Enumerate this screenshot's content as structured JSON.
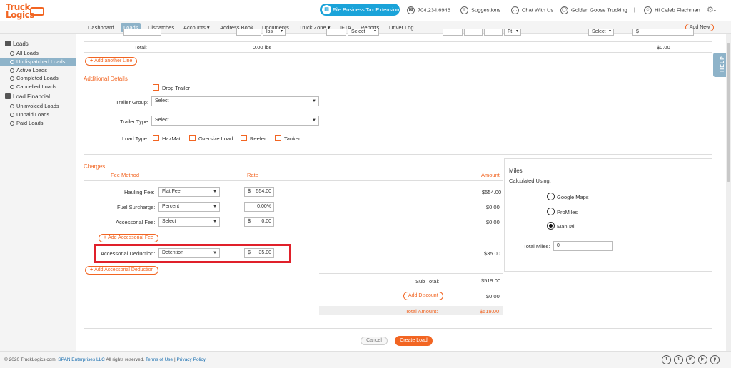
{
  "header": {
    "logo_line1": "Truck",
    "logo_line2": "Logics",
    "tax_button": "File Business Tax Extension",
    "phone": "704.234.6946",
    "suggestions": "Suggestions",
    "chat": "Chat With Us",
    "company": "Golden Goose Trucking",
    "separator": "|",
    "greeting": "Hi Caleb Flachman"
  },
  "nav": {
    "items": [
      "Dashboard",
      "Loads",
      "Dispatches",
      "Accounts ▾",
      "Address Book",
      "Documents",
      "Truck Zone ▾",
      "IFTA",
      "Reports",
      "Driver Log"
    ],
    "add_new": "Add New"
  },
  "sidebar": {
    "loads_head": "Loads",
    "loads_items": [
      "All Loads",
      "Undispatched Loads",
      "Active Loads",
      "Completed Loads",
      "Cancelled Loads"
    ],
    "financial_head": "Load Financial",
    "financial_items": [
      "Uninvoiced Loads",
      "Unpaid Loads",
      "Paid Loads"
    ]
  },
  "help_tab": "HELP",
  "line_items": {
    "unit_value": "lbs",
    "select_placeholder": "Select",
    "unit2": "Ft",
    "currency": "$",
    "total_label": "Total:",
    "total_weight": "0.00 lbs",
    "total_amount": "$0.00",
    "add_line": "Add another Line"
  },
  "additional": {
    "title": "Additional Details",
    "drop_trailer": "Drop Trailer",
    "trailer_group_label": "Trailer Group:",
    "trailer_group_value": "Select",
    "trailer_type_label": "Trailer Type:",
    "trailer_type_value": "Select",
    "load_type_label": "Load Type:",
    "load_types": [
      "HazMat",
      "Oversize Load",
      "Reefer",
      "Tanker"
    ]
  },
  "charges": {
    "title": "Charges",
    "col_fee_method": "Fee Method",
    "col_rate": "Rate",
    "col_amount": "Amount",
    "hauling_label": "Hauling Fee:",
    "hauling_method": "Flat Fee",
    "hauling_rate": "554.00",
    "hauling_amount": "$554.00",
    "fuel_label": "Fuel Surcharge:",
    "fuel_method": "Percent",
    "fuel_rate": "0.00",
    "fuel_pct": "%",
    "fuel_amount": "$0.00",
    "accessorial_label": "Accessorial Fee:",
    "accessorial_method": "Select",
    "accessorial_rate": "0.00",
    "accessorial_amount": "$0.00",
    "add_accessorial_fee": "Add Accessorial Fee",
    "deduction_label": "Accessorial Deduction:",
    "deduction_method": "Detention",
    "deduction_rate": "35.00",
    "deduction_amount": "$35.00",
    "add_deduction": "Add Accessorial Deduction",
    "subtotal_label": "Sub Total:",
    "subtotal_value": "$519.00",
    "add_discount": "Add Discount",
    "discount_value": "$0.00",
    "total_label": "Total Amount:",
    "total_value": "$519.00",
    "currency": "$"
  },
  "miles": {
    "title": "Miles",
    "calc_label": "Calculated Using:",
    "options": [
      "Google Maps",
      "ProMiles",
      "Manual"
    ],
    "selected": "Manual",
    "total_label": "Total Miles:",
    "total_value": "0"
  },
  "actions": {
    "cancel": "Cancel",
    "create": "Create Load"
  },
  "footer": {
    "copyright": "© 2020 TruckLogics.com,",
    "company_link": "SPAN Enterprises LLC",
    "rights": "All rights reserved.",
    "terms": "Terms of Use",
    "pipe": "|",
    "privacy": "Privacy Policy",
    "social": [
      "f",
      "t",
      "in",
      "▶",
      "p"
    ]
  },
  "colors": {
    "accent": "#f26522",
    "nav_active": "#8eb3c9",
    "tax_button": "#1aa3d9",
    "highlight": "#e0202a"
  }
}
